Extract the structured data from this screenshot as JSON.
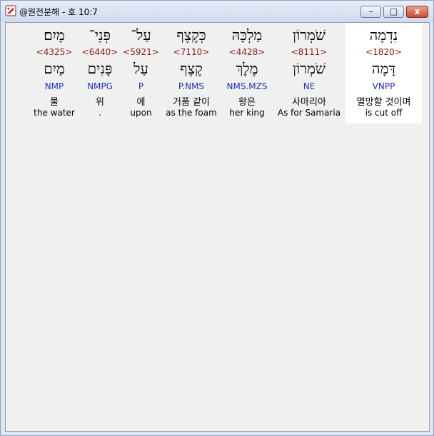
{
  "window": {
    "title": "@원전분해 - 호 10:7"
  },
  "controls": {
    "minimize": "–",
    "maximize": "□",
    "close": "x"
  },
  "words": [
    {
      "hebrew": "נִדְמֶה",
      "strong": "<1820>",
      "lexeme": "דָּמָה",
      "parse": "VNPP",
      "korean": "멸망할 것이며",
      "english": "is cut off",
      "selected": true
    },
    {
      "hebrew": "שֹׁמְרוֹן",
      "strong": "<8111>",
      "lexeme": "שֹׁמְרוֹן",
      "parse": "NE",
      "korean": "사마리아",
      "english": "As for Samaria",
      "selected": false
    },
    {
      "hebrew": "מַלְכָּהּ",
      "strong": "<4428>",
      "lexeme": "מֶלֶךְ",
      "parse": "NMS.MZS",
      "korean": "왕은",
      "english": "her king",
      "selected": false
    },
    {
      "hebrew": "כְּקֶצֶף",
      "strong": "<7110>",
      "lexeme": "קֶצֶף",
      "parse": "P.NMS",
      "korean": "거품 같이",
      "english": "as the foam",
      "selected": false
    },
    {
      "hebrew": "עַל־",
      "strong": "<5921>",
      "lexeme": "עַל",
      "parse": "P",
      "korean": "에",
      "english": "upon",
      "selected": false
    },
    {
      "hebrew": "פְּנֵי־",
      "strong": "<6440>",
      "lexeme": "פָּנִים",
      "parse": "NMPG",
      "korean": "위",
      "english": ".",
      "selected": false
    },
    {
      "hebrew": "מָיִם׃",
      "strong": "<4325>",
      "lexeme": "מַיִם",
      "parse": "NMP",
      "korean": "물",
      "english": "the water",
      "selected": false
    }
  ]
}
